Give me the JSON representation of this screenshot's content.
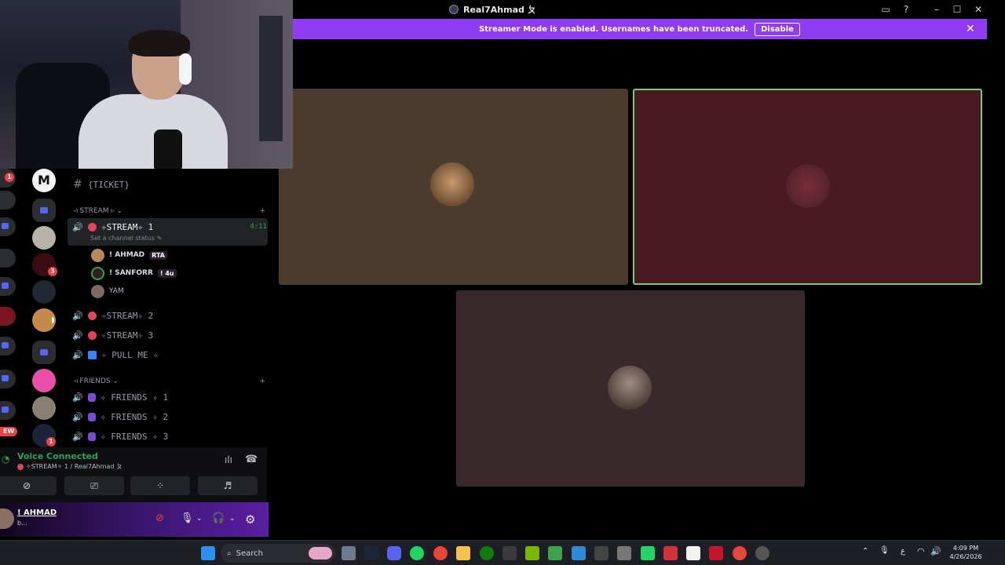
{
  "window": {
    "title": "Real7Ahmad ㄆ"
  },
  "banner": {
    "text": "Streamer Mode is enabled. Usernames have been truncated.",
    "disable_label": "Disable"
  },
  "channels": {
    "top_channel": "{TICKET}",
    "stream_category": "STREAM",
    "stream1": {
      "name": "✧STREAM✧ 1",
      "status_placeholder": "Set a channel status",
      "timer": "4:11"
    },
    "members": [
      {
        "name": "! AHMAD",
        "tag": "RTA"
      },
      {
        "name": "! SANFORR",
        "tag": "! 4u"
      },
      {
        "name": "YAM"
      }
    ],
    "stream2": "✧STREAM✧ 2",
    "stream3": "✧STREAM✧ 3",
    "pullme": "✧ PULL ME ✧",
    "friends_category": "FRIENDS",
    "friends": [
      "✧ FRIENDS ✧ 1",
      "✧ FRIENDS ✧ 2",
      "✧ FRIENDS ✧ 3"
    ]
  },
  "badges": {
    "rail_top": "1",
    "server_a": "3",
    "server_b": "1",
    "new_label": "EW"
  },
  "voice": {
    "status": "Voice Connected",
    "channel": "✧STREAM✧ 1 / Real7Ahmad ㄆ"
  },
  "user": {
    "name": "! AHMAD",
    "status": "b..."
  },
  "taskbar": {
    "search_label": "Search",
    "time": "4:09 PM",
    "date": "4/26/2026",
    "lang": "ع"
  },
  "colors": {
    "banner": "#8f3cf2",
    "voice_green": "#23a559",
    "tile1": "#4a3b2c",
    "tile2": "#4a1a22",
    "tile3": "#37292c",
    "speaking_border": "#6fcf7d"
  }
}
